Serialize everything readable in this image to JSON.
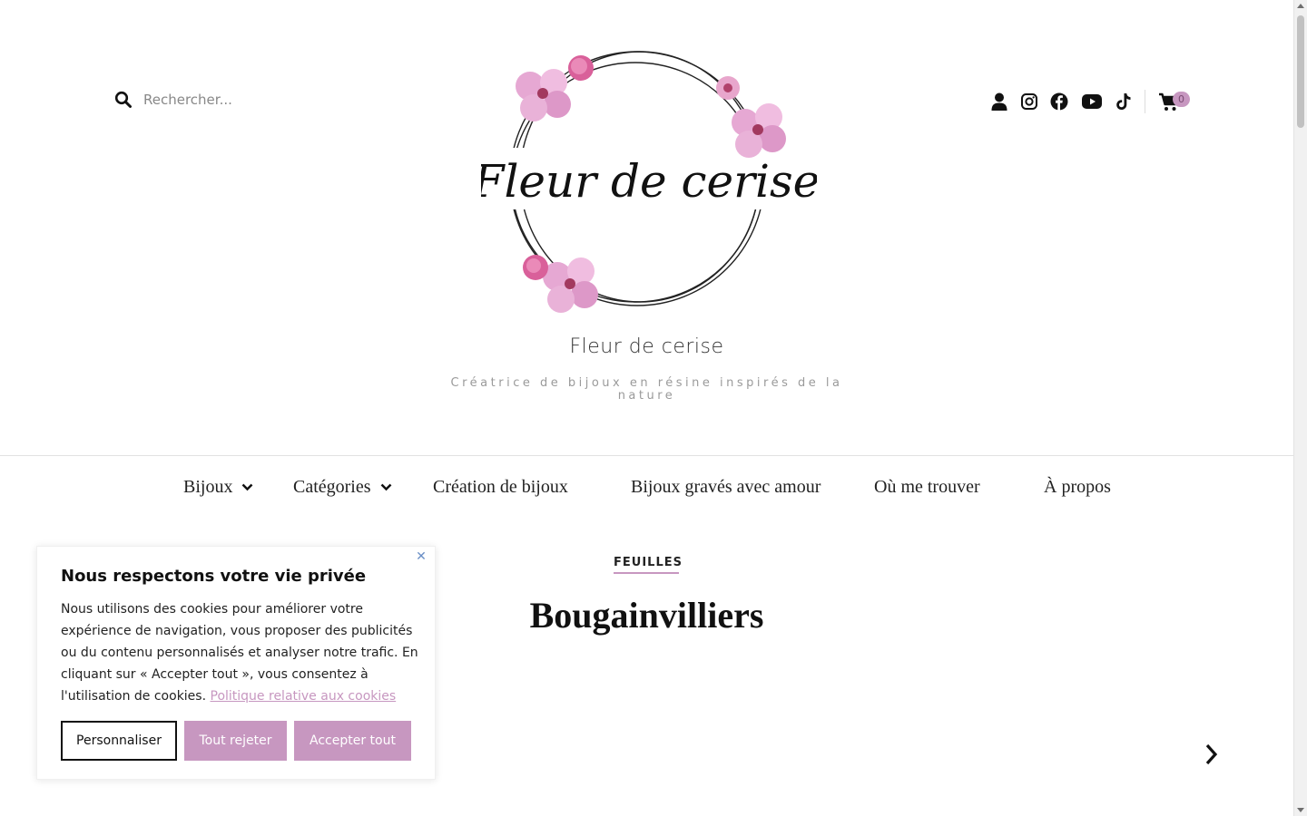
{
  "header": {
    "search_placeholder": "Rechercher...",
    "logo_text": "Fleur de cerise",
    "site_title": "Fleur de cerise",
    "tagline": "Créatrice de bijoux en résine inspirés de la nature",
    "icons": [
      "user-icon",
      "instagram-icon",
      "facebook-icon",
      "youtube-icon",
      "tiktok-icon",
      "cart-icon"
    ],
    "cart_count": "0"
  },
  "nav": {
    "items": [
      {
        "label": "Bijoux",
        "has_dropdown": true
      },
      {
        "label": "Catégories",
        "has_dropdown": true
      },
      {
        "label": "Création de bijoux",
        "has_dropdown": false
      },
      {
        "label": "Bijoux gravés avec amour",
        "has_dropdown": false
      },
      {
        "label": "Où me trouver",
        "has_dropdown": false
      },
      {
        "label": "À propos",
        "has_dropdown": false
      }
    ]
  },
  "main": {
    "category": "FEUILLES",
    "title": "Bougainvilliers"
  },
  "cookie": {
    "title": "Nous respectons votre vie privée",
    "text": "Nous utilisons des cookies pour améliorer votre expérience de navigation, vous proposer des publicités ou du contenu personnalisés et analyser notre trafic. En cliquant sur « Accepter tout », vous consentez à l'utilisation de cookies.",
    "policy_link": "Politique relative aux cookies",
    "btn_customize": "Personnaliser",
    "btn_reject": "Tout rejeter",
    "btn_accept": "Accepter tout"
  },
  "colors": {
    "accent": "#c797c0",
    "text": "#111111",
    "close_icon": "#6a8fc6"
  }
}
